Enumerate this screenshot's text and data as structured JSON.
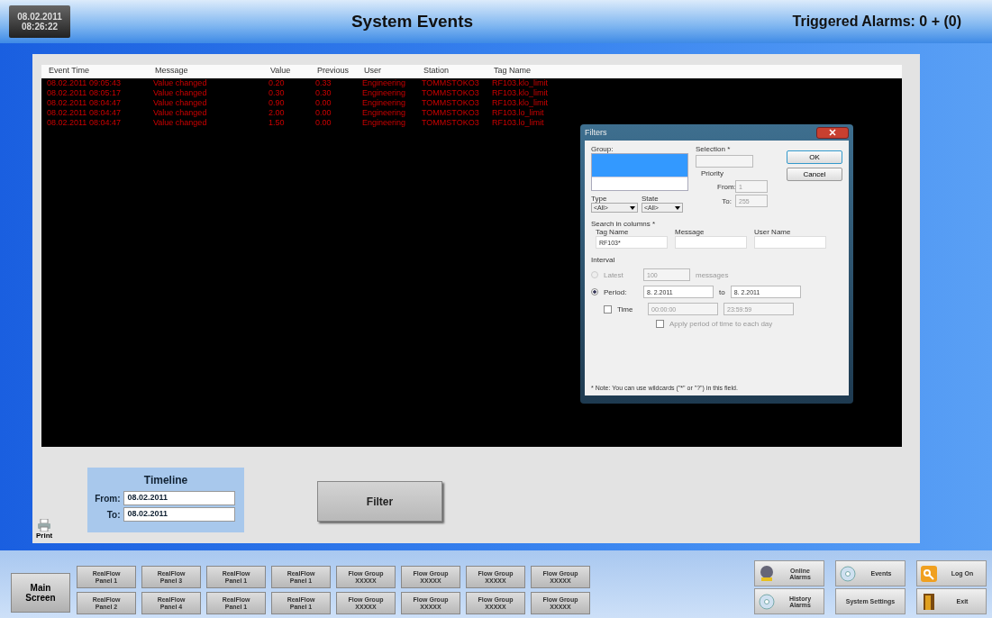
{
  "header": {
    "date": "08.02.2011",
    "time": "08:26:22",
    "title": "System Events",
    "alarms": "Triggered Alarms: 0  + (0)"
  },
  "table": {
    "columns": [
      "Event Time",
      "Message",
      "Value",
      "Previous",
      "User",
      "Station",
      "Tag Name"
    ],
    "rows": [
      [
        "08.02.2011 09:05:43",
        "Value changed",
        "0.20",
        "0.33",
        "Engineering",
        "TOMMSTOKO3",
        "RF103.klo_limit"
      ],
      [
        "08.02.2011 08:05:17",
        "Value changed",
        "0.30",
        "0.30",
        "Engineering",
        "TOMMSTOKO3",
        "RF103.klo_limit"
      ],
      [
        "08.02.2011 08:04:47",
        "Value changed",
        "0.90",
        "0.00",
        "Engineering",
        "TOMMSTOKO3",
        "RF103.klo_limit"
      ],
      [
        "08.02.2011 08:04:47",
        "Value changed",
        "2.00",
        "0.00",
        "Engineering",
        "TOMMSTOKO3",
        "RF103.lo_limit"
      ],
      [
        "08.02.2011 08:04:47",
        "Value changed",
        "1.50",
        "0.00",
        "Engineering",
        "TOMMSTOKO3",
        "RF103.lo_limit"
      ]
    ]
  },
  "dialog": {
    "title": "Filters",
    "group_label": "Group:",
    "group_items": [
      {
        "selected": true
      }
    ],
    "selection_label": "Selection *",
    "priority_label": "Priority",
    "from_label": "From:",
    "from_value": "1",
    "to_label": "To:",
    "to_value": "255",
    "type_label": "Type",
    "type_value": "<All>",
    "state_label": "State",
    "state_value": "<All>",
    "search_label": "Search in columns *",
    "search_fields": [
      {
        "label": "Tag Name",
        "value": "RF103*"
      },
      {
        "label": "Message"
      },
      {
        "label": "User Name"
      }
    ],
    "interval_label": "Interval",
    "latest": {
      "label": "Latest",
      "selected": false,
      "disabled": true,
      "value": "100",
      "unit": "messages"
    },
    "period": {
      "label": "Period:",
      "selected": true,
      "from": "8. 2.2011",
      "to_label": "to",
      "to": "8. 2.2011"
    },
    "time": {
      "label": "Time",
      "checked": false,
      "from": "00:00:00",
      "to": "23:59:59"
    },
    "apply": {
      "label": "Apply period of time to each day",
      "checked": false
    },
    "note": "* Note: You can use wildcards (\"*\" or \"?\") in this field.",
    "ok": "OK",
    "cancel": "Cancel"
  },
  "timeline": {
    "title": "Timeline",
    "from_label": "From:",
    "from": "08.02.2011",
    "to_label": "To:",
    "to": "08.02.2011"
  },
  "print": "Print",
  "filter": "Filter",
  "main_screen": "Main Screen",
  "nav_buttons": [
    [
      "RealFlow",
      "Panel 1"
    ],
    [
      "RealFlow",
      "Panel 2"
    ],
    [
      "RealFlow",
      "Panel 3"
    ],
    [
      "RealFlow",
      "Panel 4"
    ],
    [
      "RealFlow",
      "Panel 1"
    ],
    [
      "RealFlow",
      "Panel 1"
    ],
    [
      "RealFlow",
      "Panel 1"
    ],
    [
      "RealFlow",
      "Panel 1"
    ],
    [
      "Flow Group",
      "XXXXX"
    ],
    [
      "Flow Group",
      "XXXXX"
    ],
    [
      "Flow Group",
      "XXXXX"
    ],
    [
      "Flow Group",
      "XXXXX"
    ],
    [
      "Flow Group",
      "XXXXX"
    ],
    [
      "Flow Group",
      "XXXXX"
    ],
    [
      "Flow Group",
      "XXXXX"
    ],
    [
      "Flow Group",
      "XXXXX"
    ]
  ],
  "action_buttons": [
    {
      "kind": "bell",
      "label": "Online Alarms"
    },
    {
      "kind": "disc",
      "label": "Events"
    },
    {
      "kind": "key",
      "label": "Log On"
    },
    {
      "kind": "disc",
      "label": "History Alarms"
    },
    {
      "kind": "none",
      "label": "System Settings"
    },
    {
      "kind": "door",
      "label": "Exit"
    }
  ]
}
